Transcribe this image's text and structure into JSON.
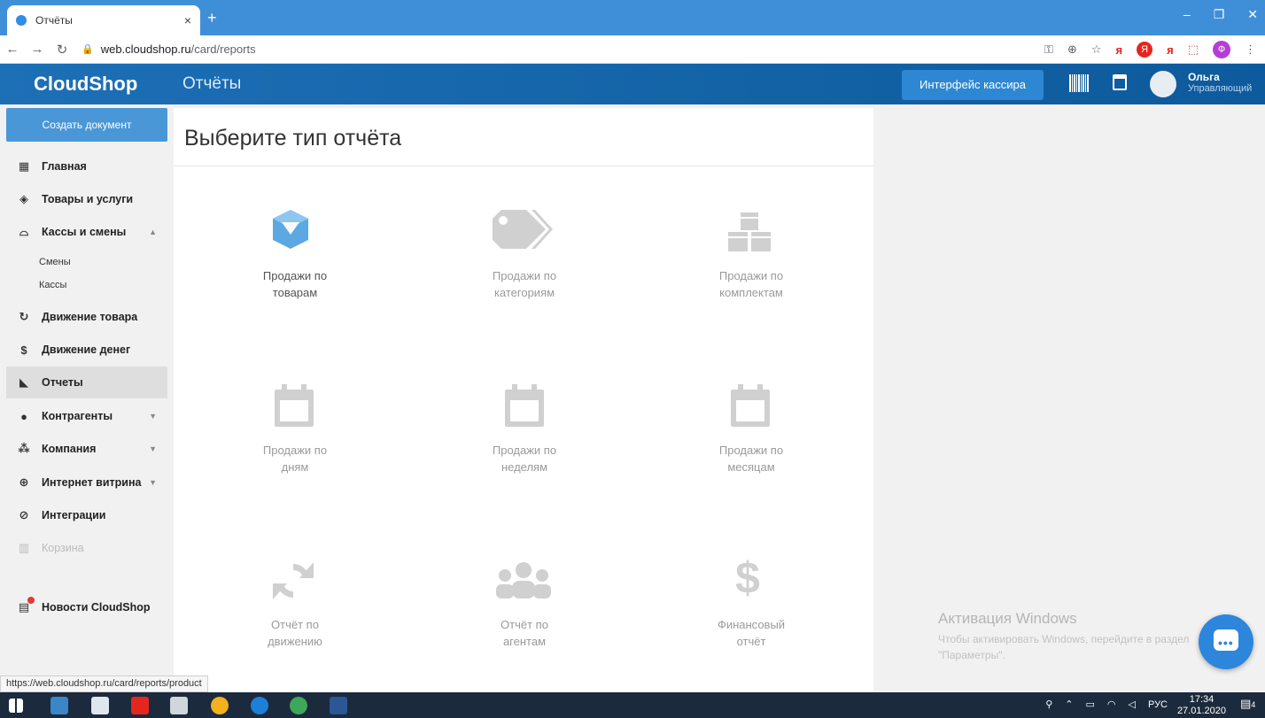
{
  "browser": {
    "tab_title": "Отчёты",
    "tab_close": "×",
    "new_tab": "+",
    "url_domain": "web.cloudshop.ru",
    "url_path": "/card/reports",
    "status_link": "https://web.cloudshop.ru/card/reports/product"
  },
  "header": {
    "logo": "CloudShop",
    "page_title": "Отчёты",
    "cashier_button": "Интерфейс кассира",
    "user_name": "Ольга",
    "user_role": "Управляющий"
  },
  "sidebar": {
    "create_button": "Создать документ",
    "items": [
      {
        "label": "Главная",
        "icon": "grid-icon"
      },
      {
        "label": "Товары и услуги",
        "icon": "box-icon"
      },
      {
        "label": "Кассы и смены",
        "icon": "register-icon",
        "expanded": true
      },
      {
        "label": "Движение товара",
        "icon": "refresh-icon"
      },
      {
        "label": "Движение денег",
        "icon": "dollar-icon"
      },
      {
        "label": "Отчеты",
        "icon": "chart-icon",
        "active": true
      },
      {
        "label": "Контрагенты",
        "icon": "user-icon"
      },
      {
        "label": "Компания",
        "icon": "group-icon"
      },
      {
        "label": "Интернет витрина",
        "icon": "globe-icon"
      },
      {
        "label": "Интеграции",
        "icon": "paperclip-icon"
      },
      {
        "label": "Корзина",
        "icon": "trash-icon",
        "disabled": true
      }
    ],
    "sub_items": [
      "Смены",
      "Кассы"
    ],
    "news": "Новости CloudShop"
  },
  "main": {
    "title": "Выберите тип отчёта",
    "reports": [
      {
        "line1": "Продажи по",
        "line2": "товарам",
        "icon": "cube-icon"
      },
      {
        "line1": "Продажи по",
        "line2": "категориям",
        "icon": "tags-icon"
      },
      {
        "line1": "Продажи по",
        "line2": "комплектам",
        "icon": "cubes-icon"
      },
      {
        "line1": "Продажи по",
        "line2": "дням",
        "icon": "calendar-icon"
      },
      {
        "line1": "Продажи по",
        "line2": "неделям",
        "icon": "calendar-icon"
      },
      {
        "line1": "Продажи по",
        "line2": "месяцам",
        "icon": "calendar-icon"
      },
      {
        "line1": "Отчёт по",
        "line2": "движению",
        "icon": "refresh-icon"
      },
      {
        "line1": "Отчёт по",
        "line2": "агентам",
        "icon": "users-icon"
      },
      {
        "line1": "Финансовый",
        "line2": "отчёт",
        "icon": "dollar-icon"
      }
    ]
  },
  "watermark": {
    "title": "Активация Windows",
    "line1": "Чтобы активировать Windows, перейдите в раздел",
    "line2": "\"Параметры\"."
  },
  "taskbar": {
    "lang": "РУС",
    "time": "17:34",
    "date": "27.01.2020",
    "notifications": "4"
  },
  "colors": {
    "header_blue": "#1d6fb6",
    "accent_blue": "#4a97d8",
    "icon_gray": "#cfcfcf",
    "icon_active": "#5ba8e3"
  }
}
